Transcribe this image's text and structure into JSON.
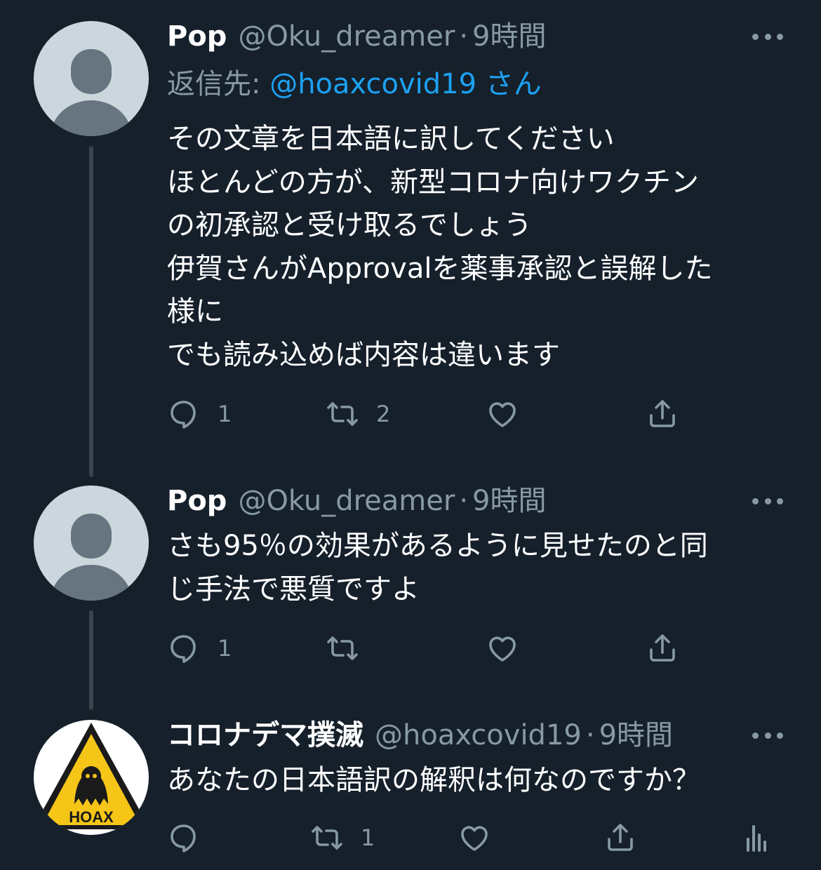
{
  "tweets": [
    {
      "name": "Pop",
      "handle": "@Oku_dreamer",
      "dot": "·",
      "time": "9時間",
      "reply_label": "返信先: ",
      "reply_handle": "@hoaxcovid19 さん",
      "body": "その文章を日本語に訳してください\nほとんどの方が、新型コロナ向けワクチン\nの初承認と受け取るでしょう\n伊賀さんがApprovalを薬事承認と誤解した\n様に\nでも読み込めば内容は違います",
      "replies": "1",
      "retweets": "2",
      "likes": "",
      "avatar_icon": "default-profile-icon"
    },
    {
      "name": "Pop",
      "handle": "@Oku_dreamer",
      "dot": "·",
      "time": "9時間",
      "body": "さも95％の効果があるように見せたのと同\nじ手法で悪質ですよ",
      "replies": "1",
      "retweets": "",
      "likes": "",
      "avatar_icon": "default-profile-icon"
    },
    {
      "name": "コロナデマ撲滅",
      "handle": "@hoaxcovid19",
      "dot": "·",
      "time": "9時間",
      "body": "あなたの日本語訳の解釈は何なのですか？",
      "replies": "",
      "retweets": "1",
      "likes": "",
      "avatar_icon": "hoax-warning-sign-icon",
      "avatar_text": "HOAX"
    }
  ],
  "colors": {
    "background": "#15202b",
    "text": "#ffffff",
    "secondary": "#8899a6",
    "link": "#1da1f2",
    "thread_line": "#38444d"
  }
}
